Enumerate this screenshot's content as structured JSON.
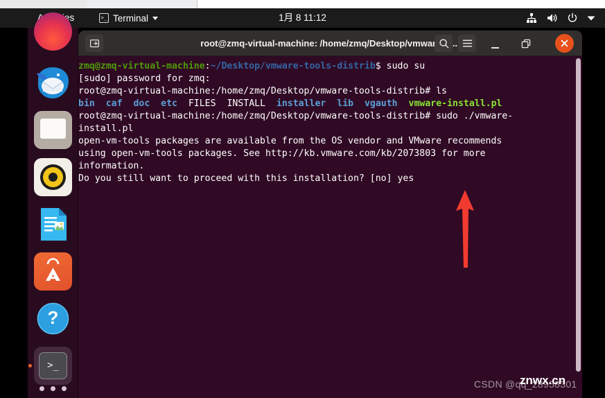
{
  "topbar": {
    "activities": "Activities",
    "app_name": "Terminal",
    "app_icon": "terminal-icon",
    "clock": "1月 8 11:12",
    "indicators": [
      {
        "name": "network-wired-icon"
      },
      {
        "name": "volume-icon"
      },
      {
        "name": "power-icon"
      },
      {
        "name": "chevron-down-icon"
      }
    ]
  },
  "dock": {
    "items": [
      {
        "name": "firefox",
        "label": "Firefox"
      },
      {
        "name": "thunderbird",
        "label": "Thunderbird Mail"
      },
      {
        "name": "files",
        "label": "Files"
      },
      {
        "name": "rhythmbox",
        "label": "Rhythmbox"
      },
      {
        "name": "libreoffice-writer",
        "label": "LibreOffice Writer"
      },
      {
        "name": "ubuntu-software",
        "label": "Ubuntu Software"
      },
      {
        "name": "help",
        "label": "Help"
      },
      {
        "name": "terminal",
        "label": "Terminal",
        "running": true
      }
    ],
    "show_apps_label": "Show Applications"
  },
  "terminal_window": {
    "title": "root@zmq-virtual-machine: /home/zmq/Desktop/vmware-to...",
    "new_tab_label": "New Tab",
    "search_label": "Search",
    "menu_label": "Menu",
    "minimize_label": "Minimize",
    "maximize_label": "Restore",
    "close_label": "Close",
    "colors": {
      "background": "#300a24",
      "titlebar": "#302f2e",
      "close_button": "#e8511c",
      "prompt_user": "#4e9a06",
      "prompt_path": "#3465a4",
      "dir_listing": "#5c9fd6",
      "executable": "#8ae234"
    }
  },
  "terminal_content": {
    "lines": [
      {
        "id": "line-1",
        "segments": [
          {
            "text": "zmq@zmq-virtual-machine",
            "style": "green"
          },
          {
            "text": ":",
            "style": "white"
          },
          {
            "text": "~/Desktop/vmware-tools-distrib",
            "style": "blue"
          },
          {
            "text": "$ sudo su",
            "style": "white"
          }
        ]
      },
      {
        "id": "line-2",
        "segments": [
          {
            "text": "[sudo] password for zmq:",
            "style": "white"
          }
        ]
      },
      {
        "id": "line-3",
        "segments": [
          {
            "text": "root@zmq-virtual-machine:/home/zmq/Desktop/vmware-tools-distrib# ls",
            "style": "white"
          }
        ]
      },
      {
        "id": "line-4",
        "segments": [
          {
            "text": "bin",
            "style": "lblue"
          },
          {
            "text": "  ",
            "style": "white"
          },
          {
            "text": "caf",
            "style": "lblue"
          },
          {
            "text": "  ",
            "style": "white"
          },
          {
            "text": "doc",
            "style": "lblue"
          },
          {
            "text": "  ",
            "style": "white"
          },
          {
            "text": "etc",
            "style": "lblue"
          },
          {
            "text": "  FILES  INSTALL  ",
            "style": "white"
          },
          {
            "text": "installer",
            "style": "lblue"
          },
          {
            "text": "  ",
            "style": "white"
          },
          {
            "text": "lib",
            "style": "lblue"
          },
          {
            "text": "  ",
            "style": "white"
          },
          {
            "text": "vgauth",
            "style": "lblue"
          },
          {
            "text": "  ",
            "style": "white"
          },
          {
            "text": "vmware-install.pl",
            "style": "execgreen"
          }
        ]
      },
      {
        "id": "line-5",
        "segments": [
          {
            "text": "root@zmq-virtual-machine:/home/zmq/Desktop/vmware-tools-distrib# sudo ./vmware-",
            "style": "white"
          }
        ]
      },
      {
        "id": "line-6",
        "segments": [
          {
            "text": "install.pl",
            "style": "white"
          }
        ]
      },
      {
        "id": "line-7",
        "segments": [
          {
            "text": "open-vm-tools packages are available from the OS vendor and VMware recommends",
            "style": "white"
          }
        ]
      },
      {
        "id": "line-8",
        "segments": [
          {
            "text": "using open-vm-tools packages. See http://kb.vmware.com/kb/2073803 for more",
            "style": "white"
          }
        ]
      },
      {
        "id": "line-9",
        "segments": [
          {
            "text": "information.",
            "style": "white"
          }
        ]
      },
      {
        "id": "line-10",
        "segments": [
          {
            "text": "Do you still want to proceed with this installation? [no] yes",
            "style": "white"
          }
        ]
      }
    ]
  },
  "annotation": {
    "arrow": {
      "name": "red-arrow-annotation",
      "direction": "up",
      "color": "#f23b30"
    }
  },
  "watermark": {
    "csdn": "CSDN @qq_28958301",
    "site": "znwx.cn"
  }
}
